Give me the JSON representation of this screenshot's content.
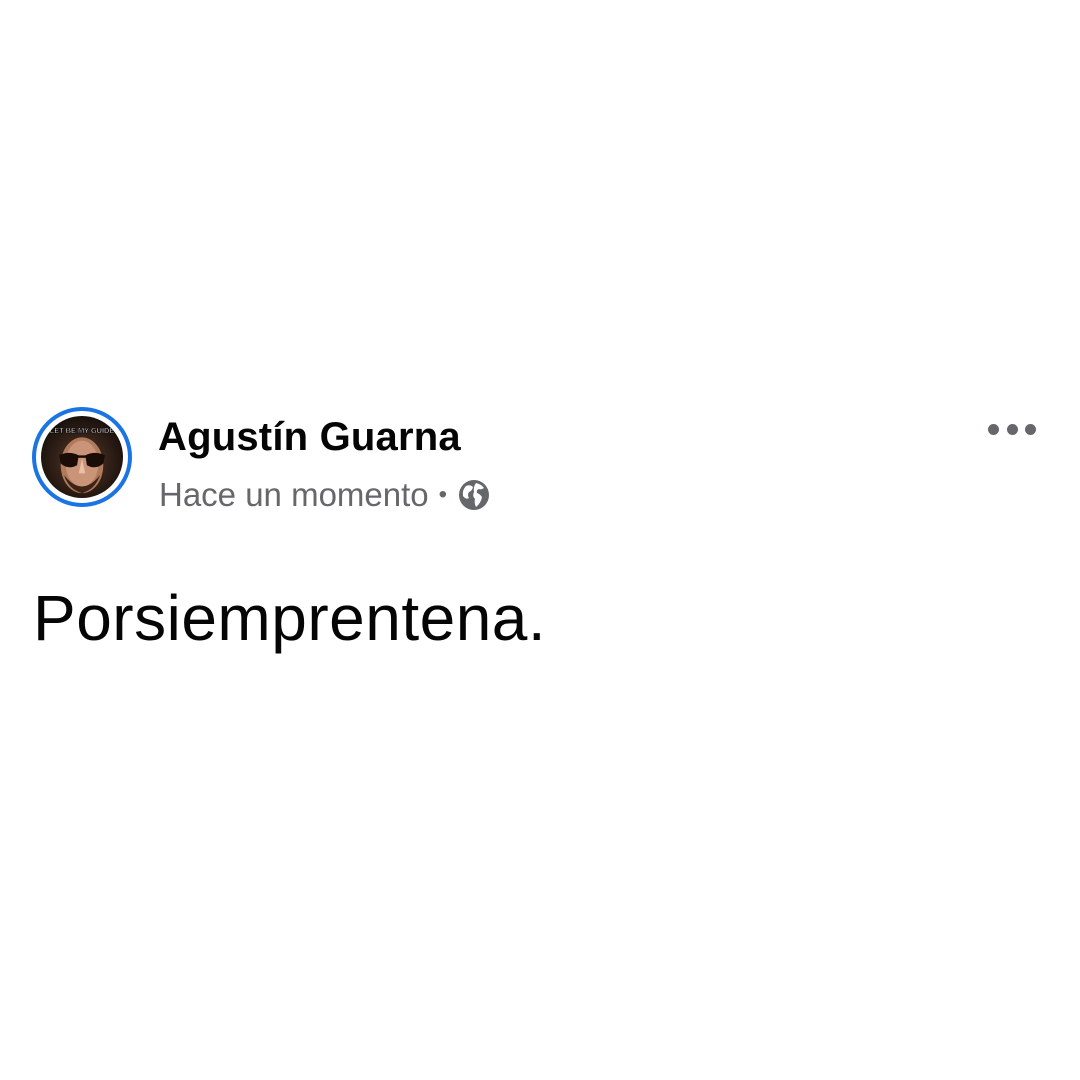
{
  "post": {
    "author_name": "Agustín Guarna",
    "timestamp": "Hace un momento",
    "separator": "•",
    "audience_icon": "globe-icon",
    "menu_icon": "more-options-icon",
    "text": "Porsiemprentena.",
    "avatar_overlay_text": "LET BE MY GUIDE"
  },
  "colors": {
    "avatar_ring": "#1b74e4",
    "author": "#050505",
    "meta": "#65676b",
    "body_text": "#050505",
    "background": "#ffffff"
  }
}
